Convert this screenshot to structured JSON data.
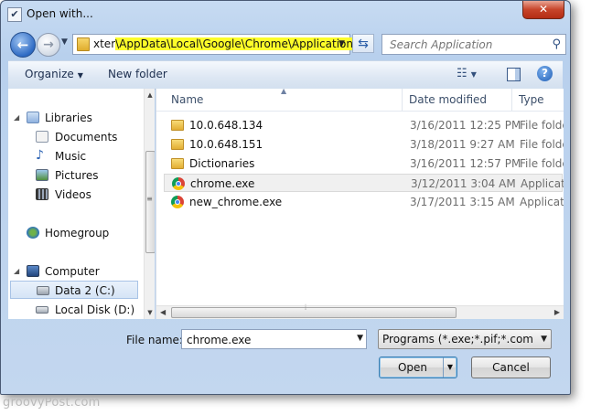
{
  "window": {
    "title": "Open with...",
    "close_glyph": "✕",
    "title_icon": "check-box-icon"
  },
  "address": {
    "path_plain": "xter",
    "path_highlight": "\\AppData\\Local\\Google\\Chrome\\Application",
    "highlight_color": "#fdfd2a"
  },
  "search": {
    "placeholder": "Search Application"
  },
  "toolbar": {
    "organize_label": "Organize",
    "new_folder_label": "New folder"
  },
  "nav": {
    "items": [
      {
        "label": "Libraries",
        "icon": "libraries-icon"
      },
      {
        "label": "Documents",
        "icon": "documents-icon"
      },
      {
        "label": "Music",
        "icon": "music-icon"
      },
      {
        "label": "Pictures",
        "icon": "pictures-icon"
      },
      {
        "label": "Videos",
        "icon": "videos-icon"
      },
      {
        "label": "Homegroup",
        "icon": "homegroup-icon"
      },
      {
        "label": "Computer",
        "icon": "computer-icon"
      },
      {
        "label": "Data 2 (C:)",
        "icon": "drive-icon",
        "selected": true
      },
      {
        "label": "Local Disk (D:)",
        "icon": "drive-icon"
      }
    ]
  },
  "files": {
    "columns": {
      "name": "Name",
      "date": "Date modified",
      "type": "Type"
    },
    "rows": [
      {
        "name": "10.0.648.134",
        "date": "3/16/2011 12:25 PM",
        "type": "File folder",
        "icon": "folder-icon"
      },
      {
        "name": "10.0.648.151",
        "date": "3/18/2011 9:27 AM",
        "type": "File folder",
        "icon": "folder-icon"
      },
      {
        "name": "Dictionaries",
        "date": "3/16/2011 12:57 PM",
        "type": "File folder",
        "icon": "folder-icon"
      },
      {
        "name": "chrome.exe",
        "date": "3/12/2011 3:04 AM",
        "type": "Application",
        "icon": "chrome-icon",
        "selected": true
      },
      {
        "name": "new_chrome.exe",
        "date": "3/17/2011 3:15 AM",
        "type": "Application",
        "icon": "chrome-icon"
      }
    ]
  },
  "form": {
    "file_name_label": "File name:",
    "file_name_value": "chrome.exe",
    "filter_value": "Programs (*.exe;*.pif;*.com;*.bat;*.cmd)",
    "open_label": "Open",
    "cancel_label": "Cancel"
  },
  "watermark": "groovyPost.com"
}
